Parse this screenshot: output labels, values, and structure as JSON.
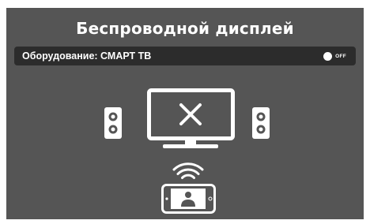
{
  "screen": {
    "title": "Беспроводной дисплей",
    "background_color": "#555555"
  },
  "hardware": {
    "label": "Оборудование: СМАРТ ТВ",
    "toggle_state": "OFF"
  },
  "icons": {
    "tv": "tv-disconnected-icon",
    "left_speaker": "speaker-icon",
    "right_speaker": "speaker-icon",
    "wifi": "wifi-signal-icon",
    "phone": "smartphone-contact-icon"
  }
}
